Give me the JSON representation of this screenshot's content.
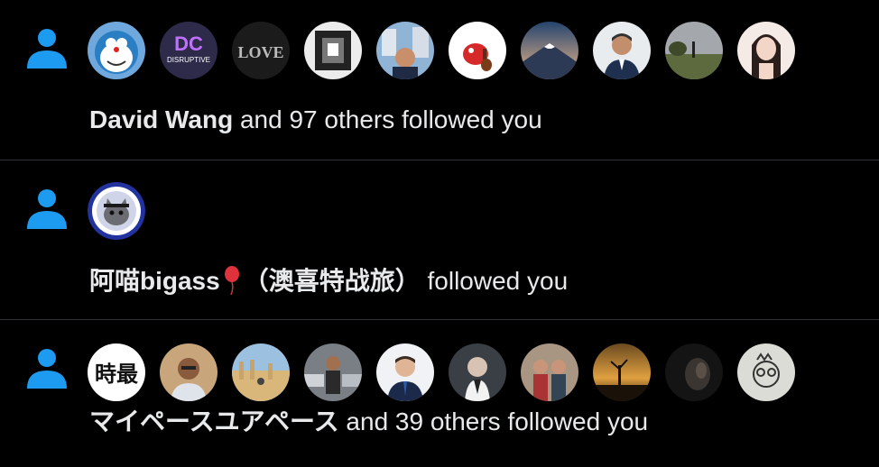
{
  "notifications": [
    {
      "type": "follow",
      "actor": "David Wang",
      "rest": " and 97 others followed you",
      "avatars": [
        {
          "name": "doraemon-avatar",
          "bg": "#6fa8dc"
        },
        {
          "name": "disruptive-concepts-avatar",
          "bg": "#2d2a4a",
          "label": "DISRUPTIVE"
        },
        {
          "name": "love-sign-avatar",
          "bg": "#1b1b1b",
          "label": "LOVE"
        },
        {
          "name": "framed-photo-avatar",
          "bg": "#ececec"
        },
        {
          "name": "man-city-avatar",
          "bg": "#8fb4d6"
        },
        {
          "name": "cartoon-creature-avatar",
          "bg": "#ffffff"
        },
        {
          "name": "mount-fuji-avatar",
          "bg": "#3c5c86"
        },
        {
          "name": "man-suit-avatar",
          "bg": "#e9ecef"
        },
        {
          "name": "park-avatar",
          "bg": "#5d6a3e"
        },
        {
          "name": "woman-portrait-avatar",
          "bg": "#f4ebe6"
        }
      ]
    },
    {
      "type": "follow",
      "actor": "阿喵bigass",
      "actor_suffix": "（澳喜特战旅）",
      "rest": " followed you",
      "avatars": [
        {
          "name": "cat-badge-avatar",
          "bg": "#2233a0"
        }
      ]
    },
    {
      "type": "follow",
      "actor": "マイペースユアペース",
      "rest": " and 39 others followed you",
      "avatars": [
        {
          "name": "calligraphy-avatar",
          "bg": "#ffffff",
          "label": "時最"
        },
        {
          "name": "man-glasses-avatar",
          "bg": "#c8a57a"
        },
        {
          "name": "ruins-avatar",
          "bg": "#d9b77a"
        },
        {
          "name": "man-cars-avatar",
          "bg": "#7a7f85"
        },
        {
          "name": "man-tie-avatar",
          "bg": "#f0f2f5"
        },
        {
          "name": "man-dark-avatar",
          "bg": "#3a3f46"
        },
        {
          "name": "two-men-avatar",
          "bg": "#8a6f60"
        },
        {
          "name": "sunset-avatar",
          "bg": "#b88a3a"
        },
        {
          "name": "shadow-face-avatar",
          "bg": "#1a1a1a"
        },
        {
          "name": "sketch-face-avatar",
          "bg": "#dcdcd6"
        }
      ]
    }
  ],
  "colors": {
    "background": "#000000",
    "text": "#e7e9ea",
    "follow_icon": "#1d9bf0",
    "divider": "#2f3336"
  }
}
